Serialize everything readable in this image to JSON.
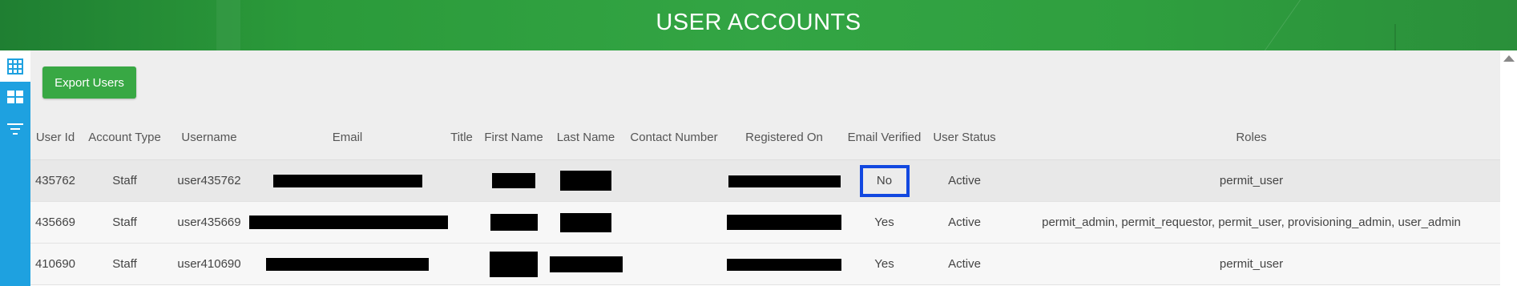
{
  "header": {
    "title": "USER ACCOUNTS"
  },
  "sidebar": {
    "items": [
      {
        "icon": "grid-icon",
        "active": true
      },
      {
        "icon": "tiles-icon",
        "active": false
      },
      {
        "icon": "filter-icon",
        "active": false
      }
    ]
  },
  "toolbar": {
    "export_label": "Export Users"
  },
  "table": {
    "columns": [
      "User Id",
      "Account Type",
      "Username",
      "Email",
      "Title",
      "First Name",
      "Last Name",
      "Contact Number",
      "Registered On",
      "Email Verified",
      "User Status",
      "Roles"
    ],
    "rows": [
      {
        "user_id": "435762",
        "account_type": "Staff",
        "username": "user435762",
        "email_verified": "No",
        "status": "Active",
        "roles": "permit_user",
        "highlighted": true
      },
      {
        "user_id": "435669",
        "account_type": "Staff",
        "username": "user435669",
        "email_verified": "Yes",
        "status": "Active",
        "roles": "permit_admin, permit_requestor, permit_user, provisioning_admin, user_admin",
        "highlighted": false
      },
      {
        "user_id": "410690",
        "account_type": "Staff",
        "username": "user410690",
        "email_verified": "Yes",
        "status": "Active",
        "roles": "permit_user",
        "highlighted": false
      }
    ]
  },
  "colors": {
    "header_green": "#2f9f3f",
    "sidebar_blue": "#1ea1e0",
    "button_green": "#38a844",
    "highlight_border": "#1248e0"
  }
}
